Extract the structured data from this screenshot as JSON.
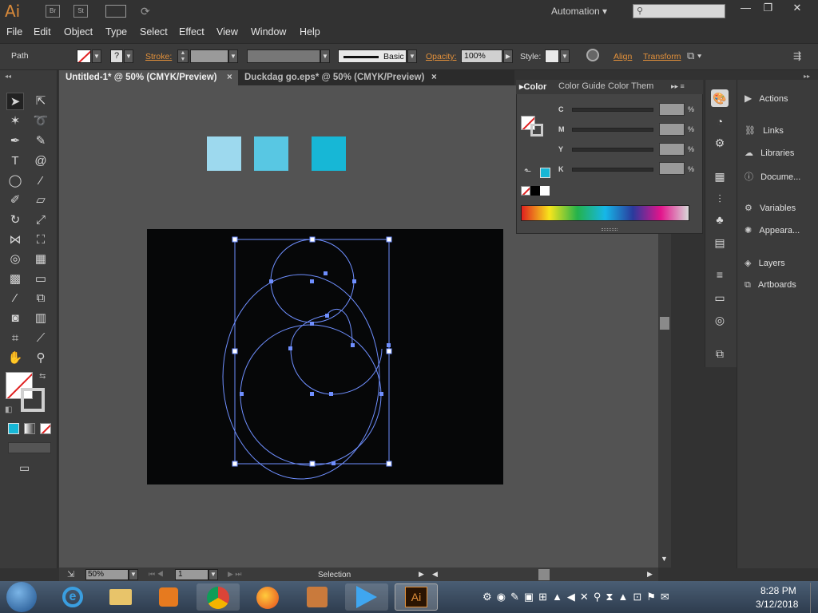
{
  "app": {
    "logo": "Ai",
    "bridge": "Br",
    "stock": "St",
    "workspace": "Automation"
  },
  "menu": [
    "File",
    "Edit",
    "Object",
    "Type",
    "Select",
    "Effect",
    "View",
    "Window",
    "Help"
  ],
  "control": {
    "selection": "Path",
    "stroke_label": "Stroke:",
    "brush": "Basic",
    "opacity_label": "Opacity:",
    "opacity": "100%",
    "style_label": "Style:",
    "align": "Align",
    "transform": "Transform"
  },
  "tabs": [
    {
      "label": "Untitled-1* @ 50% (CMYK/Preview)",
      "active": true
    },
    {
      "label": "Duckdag go.eps* @ 50% (CMYK/Preview)",
      "active": false
    }
  ],
  "swatches": [
    "#9dd9ee",
    "#58c7e3",
    "#17b7d6"
  ],
  "color_panel": {
    "tabs": [
      "Color",
      "Color Guide",
      "Color Them"
    ],
    "channels": [
      {
        "label": "C",
        "unit": "%"
      },
      {
        "label": "M",
        "unit": "%"
      },
      {
        "label": "Y",
        "unit": "%"
      },
      {
        "label": "K",
        "unit": "%"
      }
    ]
  },
  "dock": [
    "Actions",
    "Links",
    "Libraries",
    "Docume...",
    "Variables",
    "Appeara...",
    "Layers",
    "Artboards"
  ],
  "status": {
    "zoom": "50%",
    "page": "1",
    "tool": "Selection"
  },
  "taskbar": {
    "time": "8:28 PM",
    "date": "3/12/2018"
  },
  "colors": {
    "accent": "#e3913b",
    "path": "#6f8fff",
    "fill_cyan": "#17b7d6"
  }
}
